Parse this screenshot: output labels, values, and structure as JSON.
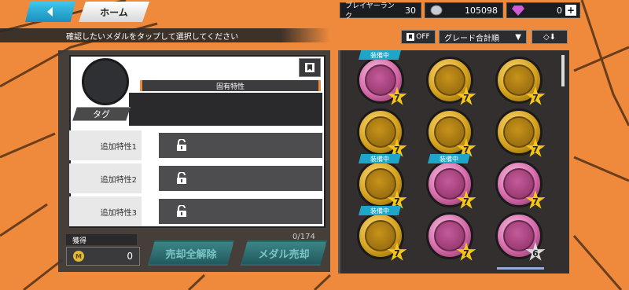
{
  "topbar": {
    "home_label": "ホーム",
    "player_rank_label": "プレイヤーランク",
    "player_rank_value": "30",
    "coins_value": "105098",
    "gems_value": "0",
    "plus_label": "+"
  },
  "instruction": "確認したいメダルをタップして選択してください",
  "controls": {
    "filter_label": "OFF",
    "sort_label": "グレード合計順",
    "sort_arrow": "▼",
    "order_label": "◇⬇"
  },
  "detail": {
    "unique_trait_label": "固有特性",
    "tag_label": "タグ",
    "extra_traits": [
      {
        "label": "追加特性1"
      },
      {
        "label": "追加特性2"
      },
      {
        "label": "追加特性3"
      }
    ]
  },
  "footer": {
    "earn_label": "獲得",
    "earn_value": "0",
    "m_symbol": "M",
    "unsell_all_label": "売却全解除",
    "sell_label": "メダル売却",
    "counter": "0/174"
  },
  "medals": [
    {
      "color": "pink",
      "grade": "7",
      "equipped": true,
      "equip_label": "装備中"
    },
    {
      "color": "gold",
      "grade": "7",
      "equipped": false
    },
    {
      "color": "gold",
      "grade": "7",
      "equipped": false
    },
    {
      "color": "gold",
      "grade": "7",
      "equipped": false
    },
    {
      "color": "gold",
      "grade": "7",
      "equipped": false
    },
    {
      "color": "gold",
      "grade": "7",
      "equipped": false
    },
    {
      "color": "gold",
      "grade": "7",
      "equipped": true,
      "equip_label": "装備中"
    },
    {
      "color": "pink",
      "grade": "7",
      "equipped": true,
      "equip_label": "装備中"
    },
    {
      "color": "pink",
      "grade": "7",
      "equipped": false
    },
    {
      "color": "gold",
      "grade": "7",
      "equipped": true,
      "equip_label": "装備中"
    },
    {
      "color": "pink",
      "grade": "7",
      "equipped": false
    },
    {
      "color": "pink",
      "grade": "6",
      "equipped": false
    }
  ]
}
